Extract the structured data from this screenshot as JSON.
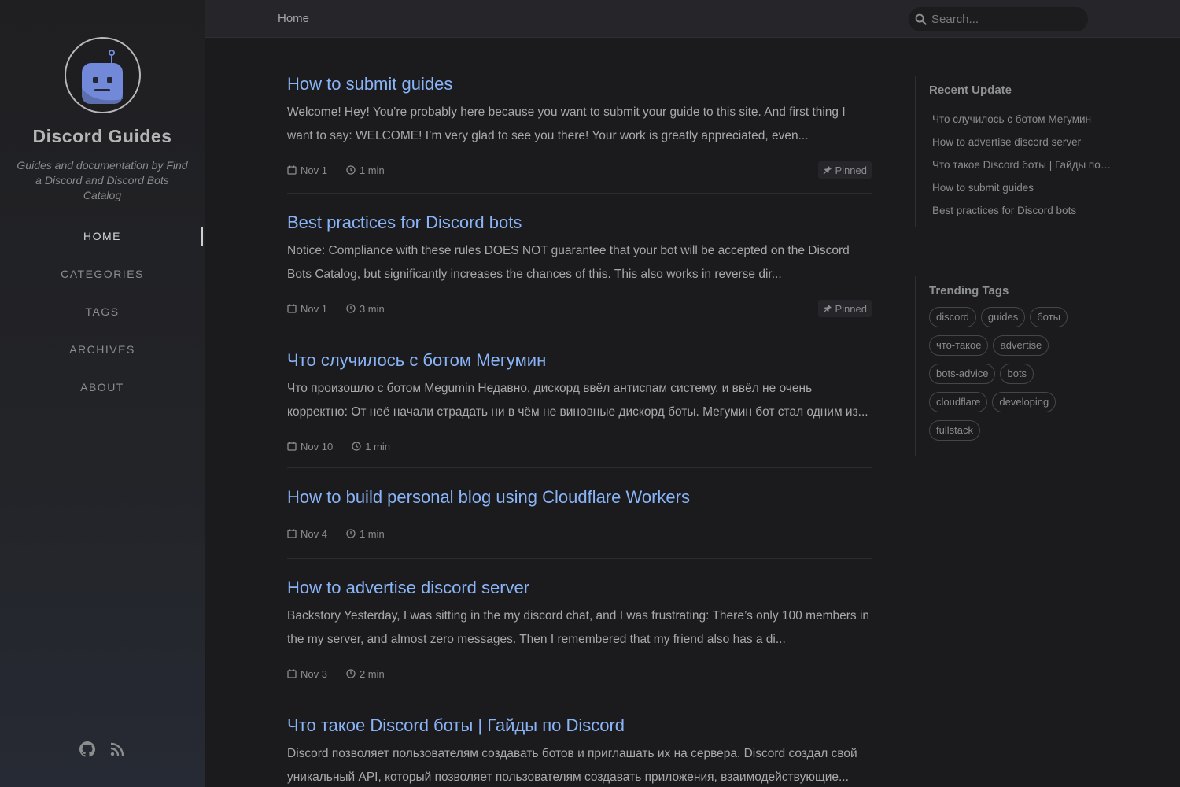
{
  "site": {
    "title": "Discord Guides",
    "subtitle": "Guides and documentation by Find a Discord and Discord Bots Catalog"
  },
  "nav": {
    "items": [
      "HOME",
      "CATEGORIES",
      "TAGS",
      "ARCHIVES",
      "ABOUT"
    ],
    "active": "HOME"
  },
  "sidebar_icons": [
    "github-icon",
    "rss-icon"
  ],
  "topbar": {
    "breadcrumb": "Home",
    "search_placeholder": "Search..."
  },
  "posts": [
    {
      "title": "How to submit guides",
      "excerpt": "Welcome! Hey! You’re probably here because you want to submit your guide to this site. And first thing I want to say: WELCOME! I’m very glad to see you there! Your work is greatly appreciated, even...",
      "date": "Nov 1",
      "read_time": "1 min",
      "pinned": "Pinned"
    },
    {
      "title": "Best practices for Discord bots",
      "excerpt": "Notice: Compliance with these rules DOES NOT guarantee that your bot will be accepted on the Discord Bots Catalog, but significantly increases the chances of this. This also works in reverse dir...",
      "date": "Nov 1",
      "read_time": "3 min",
      "pinned": "Pinned"
    },
    {
      "title": "Что случилось с ботом Мегумин",
      "excerpt": "Что произошло с ботом Megumin Недавно, дискорд ввёл антиспам систему, и ввёл не очень корректно: От неё начали страдать ни в чём не виновные дискорд боты. Мегумин бот стал одним из...",
      "date": "Nov 10",
      "read_time": "1 min",
      "pinned": ""
    },
    {
      "title": "How to build personal blog using Cloudflare Workers",
      "excerpt": "",
      "date": "Nov 4",
      "read_time": "1 min",
      "pinned": ""
    },
    {
      "title": "How to advertise discord server",
      "excerpt": "Backstory Yesterday, I was sitting in the my discord chat, and I was frustrating: There’s only 100 members in the my server, and almost zero messages. Then I remembered that my friend also has a di...",
      "date": "Nov 3",
      "read_time": "2 min",
      "pinned": ""
    },
    {
      "title": "Что такое Discord боты | Гайды по Discord",
      "excerpt": "Discord позволяет пользователям создавать ботов и приглашать их на сервера. Discord создал свой уникальный API, который позволяет пользователям создавать приложения, взаимодействующие...",
      "date": "",
      "read_time": "",
      "pinned": ""
    }
  ],
  "panel": {
    "recent_heading": "Recent Update",
    "recent": [
      "Что случилось с ботом Мегумин",
      "How to advertise discord server",
      "Что такое Discord боты | Гайды по Discord",
      "How to submit guides",
      "Best practices for Discord bots"
    ],
    "tags_heading": "Trending Tags",
    "tags": [
      "discord",
      "guides",
      "боты",
      "что-такое",
      "advertise",
      "bots-advice",
      "bots",
      "cloudflare",
      "developing",
      "fullstack"
    ]
  },
  "colors": {
    "background": "#1b1b1e",
    "link": "#8ab4f8",
    "bot_avatar": "#7289da"
  }
}
